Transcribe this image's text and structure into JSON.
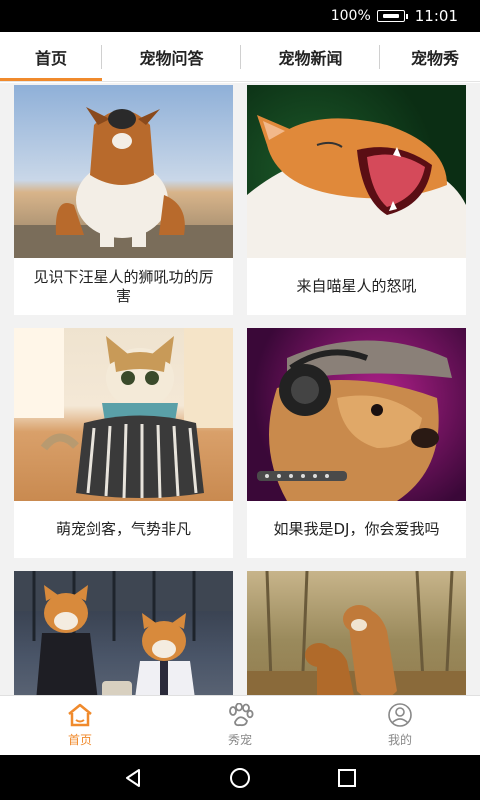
{
  "status_bar": {
    "battery_percent": "100%",
    "time": "11:01"
  },
  "tabs": [
    {
      "label": "首页",
      "active": true
    },
    {
      "label": "宠物问答",
      "active": false
    },
    {
      "label": "宠物新闻",
      "active": false
    },
    {
      "label": "宠物秀",
      "active": false
    }
  ],
  "cards": [
    {
      "caption": "见识下汪星人的狮吼功的厉害",
      "photo": "howling-corgi"
    },
    {
      "caption": "来自喵星人的怒吼",
      "photo": "yawning-cat"
    },
    {
      "caption": "萌宠剑客，气势非凡",
      "photo": "cat-in-kimono"
    },
    {
      "caption": "如果我是DJ，你会爱我吗",
      "photo": "puppy-with-headphones"
    },
    {
      "caption": "",
      "photo": "shiba-inus-in-costume"
    },
    {
      "caption": "",
      "photo": "shiba-inus-playing"
    }
  ],
  "bottom_nav": [
    {
      "label": "首页",
      "icon": "home-icon",
      "active": true
    },
    {
      "label": "秀宠",
      "icon": "paw-icon",
      "active": false
    },
    {
      "label": "我的",
      "icon": "user-icon",
      "active": false
    }
  ],
  "colors": {
    "accent": "#f08a2c",
    "inactive": "#888888"
  }
}
